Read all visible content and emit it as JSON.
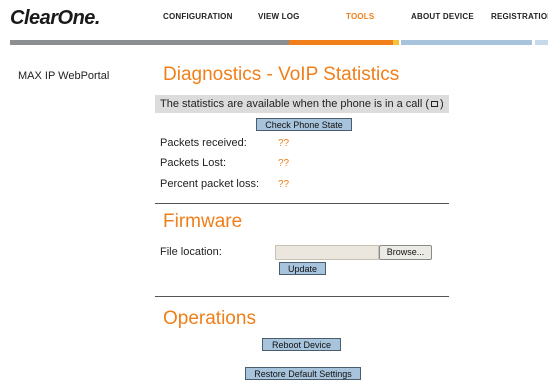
{
  "brand": {
    "logo": "ClearOne."
  },
  "nav": {
    "items": [
      {
        "label": "CONFIGURATION"
      },
      {
        "label": "VIEW LOG"
      },
      {
        "label": "TOOLS"
      },
      {
        "label": "ABOUT DEVICE"
      },
      {
        "label": "REGISTRATION"
      }
    ],
    "active": "TOOLS"
  },
  "colors": {
    "accent": "#f07f1a",
    "bar_gray": "#8b8f91",
    "bar_blue": "#a7c4dc",
    "button_bg": "#a7c4dc"
  },
  "sidebar": {
    "label": "MAX IP WebPortal"
  },
  "diagnostics": {
    "title": "Diagnostics - VoIP Statistics",
    "notice_before": "The statistics are available when the phone is in a call (",
    "notice_after": ")",
    "check_button": "Check Phone State",
    "stats": [
      {
        "label": "Packets received:",
        "value": "??"
      },
      {
        "label": "Packets Lost:",
        "value": "??"
      },
      {
        "label": "Percent packet loss:",
        "value": "??"
      }
    ]
  },
  "firmware": {
    "title": "Firmware",
    "file_label": "File location:",
    "file_value": "",
    "browse_button": "Browse...",
    "update_button": "Update"
  },
  "operations": {
    "title": "Operations",
    "reboot_button": "Reboot Device",
    "restore_button": "Restore Default Settings"
  }
}
